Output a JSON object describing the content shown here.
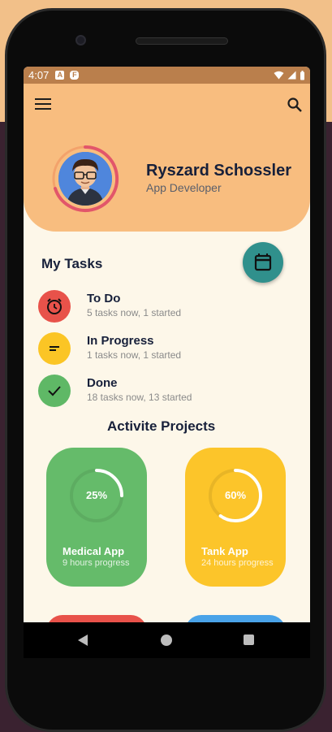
{
  "status_bar": {
    "time": "4:07",
    "badge1": "A",
    "badge2": "F"
  },
  "header": {
    "menu_icon": "menu-icon",
    "search_icon": "search-icon"
  },
  "profile": {
    "name": "Ryszard Schossler",
    "role": "App Developer"
  },
  "my_tasks": {
    "title": "My Tasks",
    "calendar_icon": "calendar-icon",
    "items": [
      {
        "title": "To Do",
        "subtitle": "5 tasks now, 1 started",
        "icon": "alarm-icon",
        "color": "#e8524a"
      },
      {
        "title": "In Progress",
        "subtitle": "1 tasks now, 1 started",
        "icon": "notes-icon",
        "color": "#fbc525"
      },
      {
        "title": "Done",
        "subtitle": "18 tasks now, 13 started",
        "icon": "check-icon",
        "color": "#5fb866"
      }
    ]
  },
  "projects": {
    "title": "Activite Projects",
    "items": [
      {
        "percent_label": "25%",
        "progress": 0.25,
        "name": "Medical App",
        "subtitle": "9 hours progress",
        "color": "#65bb6a"
      },
      {
        "percent_label": "60%",
        "progress": 0.6,
        "name": "Tank App",
        "subtitle": "24 hours progress",
        "color": "#fcc52a"
      }
    ],
    "peek_colors": [
      "#e8524a",
      "#4aa3e8"
    ]
  },
  "nav": {
    "back_icon": "back-icon",
    "home_icon": "home-icon",
    "recents_icon": "recents-icon"
  }
}
